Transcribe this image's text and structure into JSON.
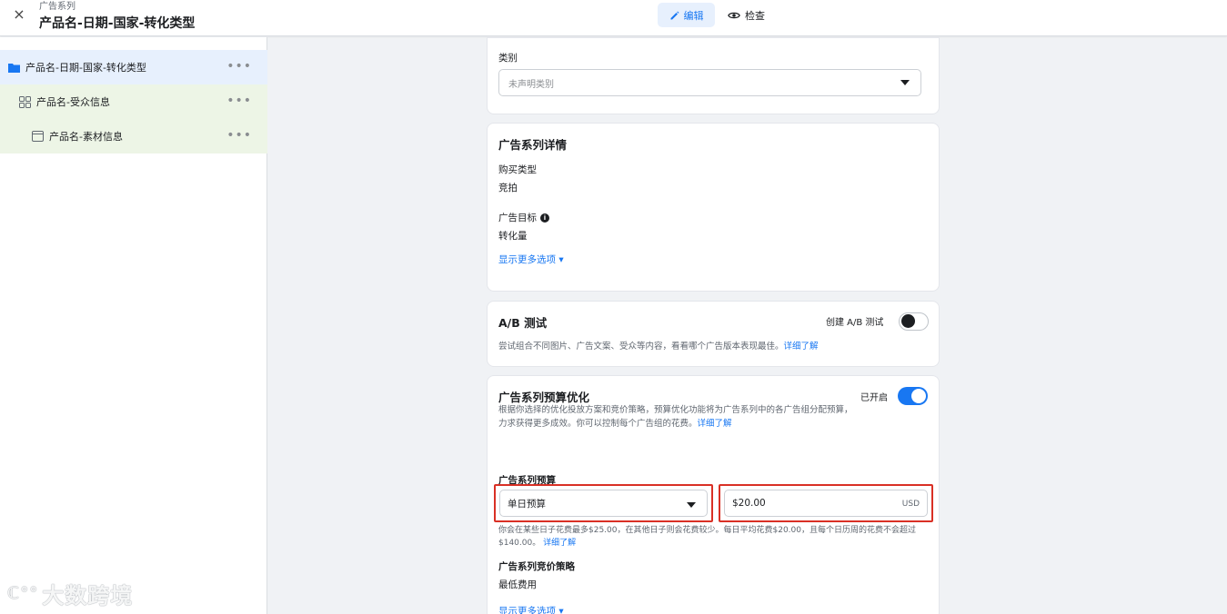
{
  "header": {
    "subtitle": "广告系列",
    "title": "产品名-日期-国家-转化类型",
    "close_icon": "×",
    "edit_label": "编辑",
    "review_label": "检查"
  },
  "sidebar": {
    "items": [
      {
        "label": "产品名-日期-国家-转化类型",
        "icon": "folder-icon",
        "more": "•••"
      },
      {
        "label": "产品名-受众信息",
        "icon": "grid-icon",
        "more": "•••"
      },
      {
        "label": "产品名-素材信息",
        "icon": "ad-icon",
        "more": "•••"
      }
    ],
    "watermark": "大数跨境"
  },
  "category": {
    "label": "类别",
    "placeholder": "未声明类别"
  },
  "details": {
    "heading": "广告系列详情",
    "buy_type_label": "购买类型",
    "buy_type_value": "竞拍",
    "objective_label": "广告目标",
    "objective_value": "转化量",
    "more_options": "显示更多选项 ▾"
  },
  "ab_test": {
    "heading": "A/B 测试",
    "toggle_label": "创建 A/B 测试",
    "toggle_on": false,
    "desc": "尝试组合不同图片、广告文案、受众等内容，看看哪个广告版本表现最佳。",
    "learn_more": "详细了解"
  },
  "budget_opt": {
    "heading": "广告系列预算优化",
    "toggle_label": "已开启",
    "toggle_on": true,
    "desc": "根据你选择的优化投放方案和竞价策略，预算优化功能将为广告系列中的各广告组分配预算，力求获得更多成效。你可以控制每个广告组的花费。",
    "learn_more": "详细了解",
    "budget_label": "广告系列预算",
    "budget_type": "单日预算",
    "budget_amount": "$20.00",
    "currency": "USD",
    "budget_note": "你会在某些日子花费最多$25.00，在其他日子则会花费较少。每日平均花费$20.00，且每个日历周的花费不会超过$140.00。",
    "budget_learn_more": "详细了解",
    "bid_label": "广告系列竞价策略",
    "bid_value": "最低费用",
    "more_options": "显示更多选项 ▾"
  },
  "colors": {
    "accent": "#1877f2",
    "highlight_box": "#d93025"
  }
}
